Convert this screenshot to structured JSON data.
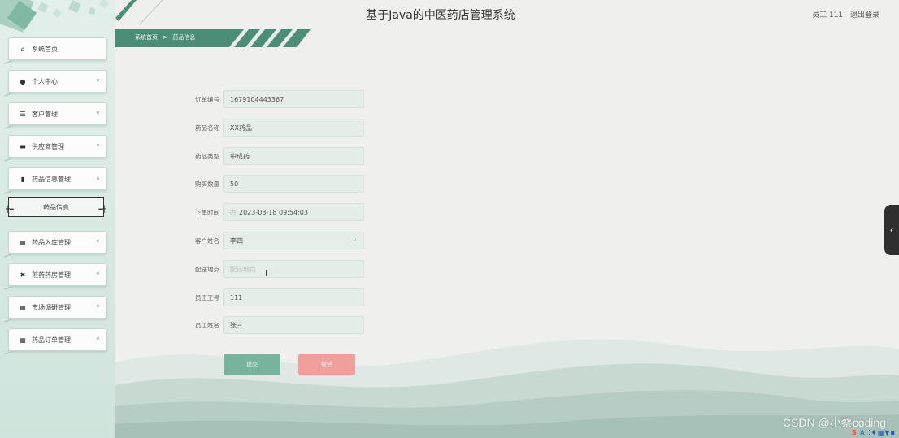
{
  "app": {
    "title": "基于Java的中医药店管理系统",
    "user_label": "员工 111",
    "logout_label": "退出登录"
  },
  "breadcrumb": {
    "home": "系统首页",
    "separator": ">",
    "current": "药品信息"
  },
  "sidebar": {
    "items": [
      {
        "label": "系统首页",
        "icon": "home-icon",
        "glyph": "⌂",
        "has_chevron": false
      },
      {
        "label": "个人中心",
        "icon": "user-icon",
        "glyph": "●",
        "has_chevron": true
      },
      {
        "label": "客户管理",
        "icon": "sliders-icon",
        "glyph": "☰",
        "has_chevron": true
      },
      {
        "label": "供应商管理",
        "icon": "monitor-icon",
        "glyph": "▬",
        "has_chevron": true
      },
      {
        "label": "药品信息管理",
        "icon": "bar-chart-icon",
        "glyph": "▮",
        "has_chevron": true
      },
      {
        "label": "药品入库管理",
        "icon": "grid-icon",
        "glyph": "▦",
        "has_chevron": true
      },
      {
        "label": "煎药药房管理",
        "icon": "pot-icon",
        "glyph": "✖",
        "has_chevron": true
      },
      {
        "label": "市场调研管理",
        "icon": "grid-icon",
        "glyph": "▦",
        "has_chevron": true
      },
      {
        "label": "药品订单管理",
        "icon": "grid-icon",
        "glyph": "▦",
        "has_chevron": true
      }
    ],
    "submenu_active": "药品信息"
  },
  "form": {
    "fields": [
      {
        "label": "订单编号",
        "value": "1679104443367",
        "type": "text"
      },
      {
        "label": "药品名称",
        "value": "XX药品",
        "type": "text"
      },
      {
        "label": "药品类型",
        "value": "中成药",
        "type": "text"
      },
      {
        "label": "购买数量",
        "value": "50",
        "type": "text"
      },
      {
        "label": "下单时间",
        "value": "2023-03-18 09:54:03",
        "type": "datetime"
      },
      {
        "label": "客户姓名",
        "value": "李四",
        "type": "select"
      },
      {
        "label": "配送地点",
        "value": "",
        "placeholder": "配送地点",
        "type": "text"
      },
      {
        "label": "员工工号",
        "value": "111",
        "type": "text"
      },
      {
        "label": "员工姓名",
        "value": "张三",
        "type": "text"
      }
    ],
    "submit_label": "提交",
    "cancel_label": "取消"
  },
  "watermark": "CSDN @小蔡coding",
  "colors": {
    "accent": "#4b8d76",
    "submit": "#78b39d",
    "cancel": "#f0a09b"
  }
}
